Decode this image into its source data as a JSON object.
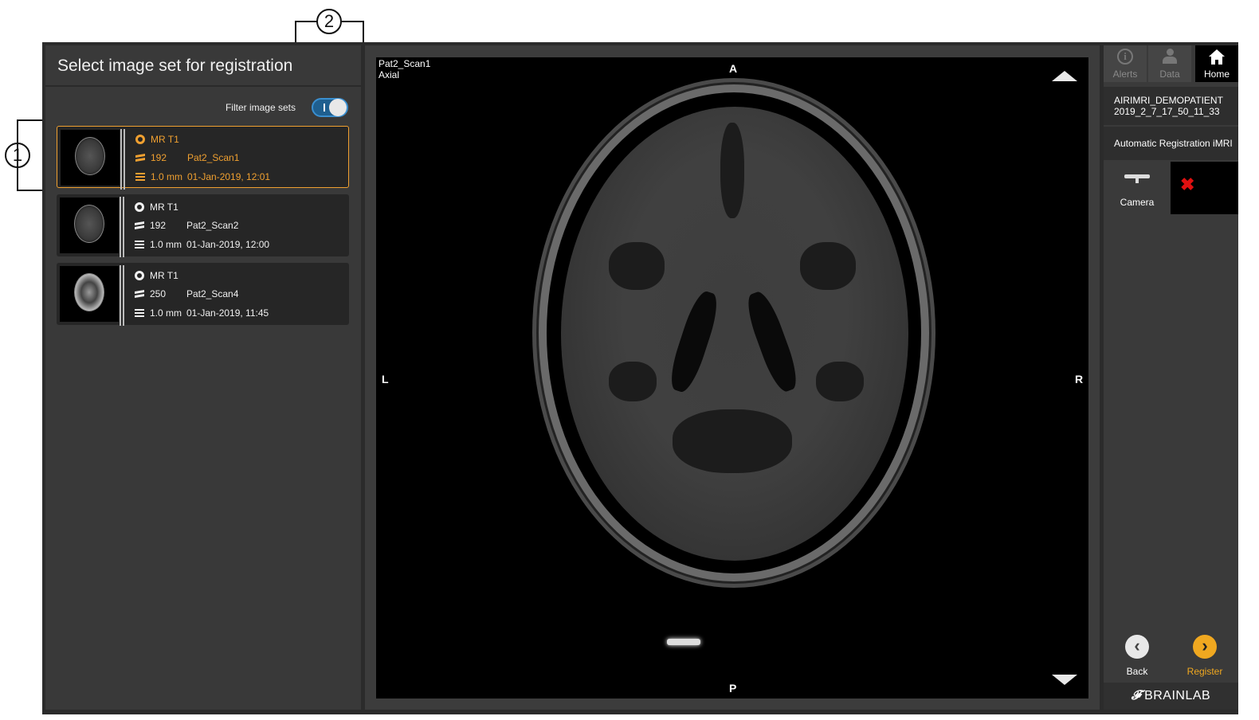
{
  "callouts": {
    "one": "1",
    "two": "2"
  },
  "left_panel": {
    "title": "Select image set for registration",
    "filter_label": "Filter image sets",
    "filter_toggle_on": true,
    "scans": [
      {
        "modality": "MR T1",
        "slices": "192",
        "name": "Pat2_Scan1",
        "thickness": "1.0 mm",
        "date": "01-Jan-2019, 12:01",
        "selected": true
      },
      {
        "modality": "MR T1",
        "slices": "192",
        "name": "Pat2_Scan2",
        "thickness": "1.0 mm",
        "date": "01-Jan-2019, 12:00",
        "selected": false
      },
      {
        "modality": "MR T1",
        "slices": "250",
        "name": "Pat2_Scan4",
        "thickness": "1.0 mm",
        "date": "01-Jan-2019, 11:45",
        "selected": false
      }
    ]
  },
  "viewer": {
    "scan_name": "Pat2_Scan1",
    "plane": "Axial",
    "orientation": {
      "top": "A",
      "bottom": "P",
      "left": "L",
      "right": "R"
    }
  },
  "right_panel": {
    "tabs": [
      {
        "label": "Alerts",
        "icon": "info-icon"
      },
      {
        "label": "Data",
        "icon": "patient-data-icon"
      },
      {
        "label": "Home",
        "icon": "home-icon"
      }
    ],
    "patient_name": "AIRIMRI_DEMOPATIENT",
    "patient_date": "2019_2_7_17_50_11_33",
    "workflow": "Automatic Registration iMRI",
    "camera_label": "Camera",
    "camera_status_icon": "error-x-icon",
    "back_label": "Back",
    "register_label": "Register",
    "brand": "BRAINLAB"
  },
  "colors": {
    "accent": "#f0a030",
    "status_error": "#e01010",
    "toggle": "#1f5f8f"
  }
}
